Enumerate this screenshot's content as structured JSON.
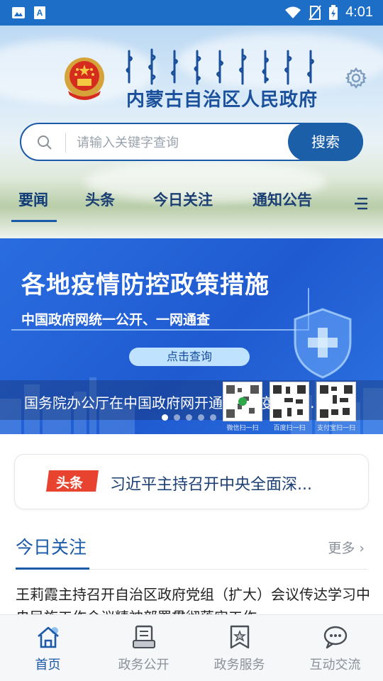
{
  "status_bar": {
    "time": "4:01",
    "icons": [
      "image-icon",
      "text-a-icon",
      "wifi-icon",
      "no-sim-icon",
      "battery-charging-icon"
    ]
  },
  "header": {
    "title": "内蒙古自治区人民政府",
    "settings_icon": "gear-icon",
    "search": {
      "placeholder": "请输入关键字查询",
      "button_label": "搜索"
    },
    "tabs": [
      {
        "label": "要闻",
        "active": true
      },
      {
        "label": "头条",
        "active": false
      },
      {
        "label": "今日关注",
        "active": false
      },
      {
        "label": "通知公告",
        "active": false
      }
    ],
    "menu_icon": "menu-icon"
  },
  "banner": {
    "headline": "各地疫情防控政策措施",
    "subtitle": "中国政府网统一公开、一网通查",
    "query_button": "点击查询",
    "caption": "国务院办公厅在中国政府网开通“各地疫情防...",
    "qr_labels": [
      "微信扫一扫",
      "百度扫一扫",
      "支付宝扫一扫"
    ],
    "slide_count": 5,
    "active_slide": 0
  },
  "headline_card": {
    "tag": "头条",
    "text": "习近平主持召开中央全面深..."
  },
  "today_focus": {
    "title": "今日关注",
    "more_label": "更多",
    "items": [
      {
        "text": "王莉霞主持召开自治区政府党组（扩大）会议传达学习中央民族工作会议精神部署贯彻落实工作"
      }
    ]
  },
  "bottom_nav": [
    {
      "label": "首页",
      "icon": "home-icon",
      "active": true
    },
    {
      "label": "政务公开",
      "icon": "document-icon",
      "active": false
    },
    {
      "label": "政务服务",
      "icon": "star-badge-icon",
      "active": false
    },
    {
      "label": "互动交流",
      "icon": "chat-icon",
      "active": false
    }
  ],
  "colors": {
    "primary": "#1a5aa8",
    "banner_blue": "#2565d8",
    "tag_red": "#e8432e"
  }
}
